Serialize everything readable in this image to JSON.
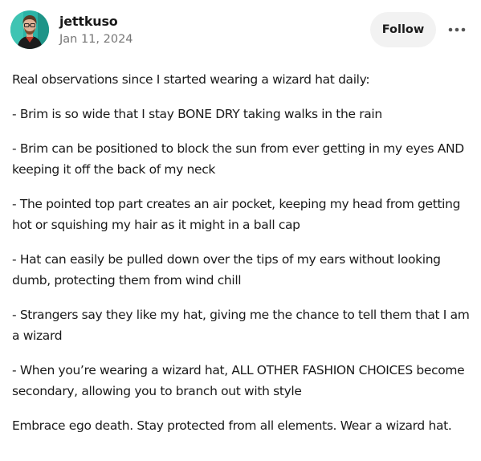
{
  "author": {
    "name": "jettkuso",
    "date": "Jan 11, 2024",
    "avatar_icon": "avatar-photo"
  },
  "actions": {
    "follow_label": "Follow",
    "more_icon": "more-horizontal-icon"
  },
  "colors": {
    "avatar_bg": "#2bb3a6",
    "button_bg": "#f2f2f2",
    "muted_text": "#767676"
  },
  "post": {
    "paragraphs": [
      "Real observations since I started wearing a wizard hat daily:",
      "- Brim is so wide that I stay BONE DRY taking walks in the rain",
      "- Brim can be positioned to block the sun from ever getting in my eyes AND keeping it off the back of my neck",
      "- The pointed top part creates an air pocket, keeping my head from getting hot or squishing my hair as it might in a ball cap",
      "- Hat can easily be pulled down over the tips of my ears without looking dumb, protecting them from wind chill",
      "- Strangers say they like my hat, giving me the chance to tell them that I am a wizard",
      "- When you’re wearing a wizard hat, ALL OTHER FASHION CHOICES become secondary, allowing you to branch out with style",
      "Embrace ego death. Stay protected from all elements. Wear a wizard hat."
    ]
  }
}
